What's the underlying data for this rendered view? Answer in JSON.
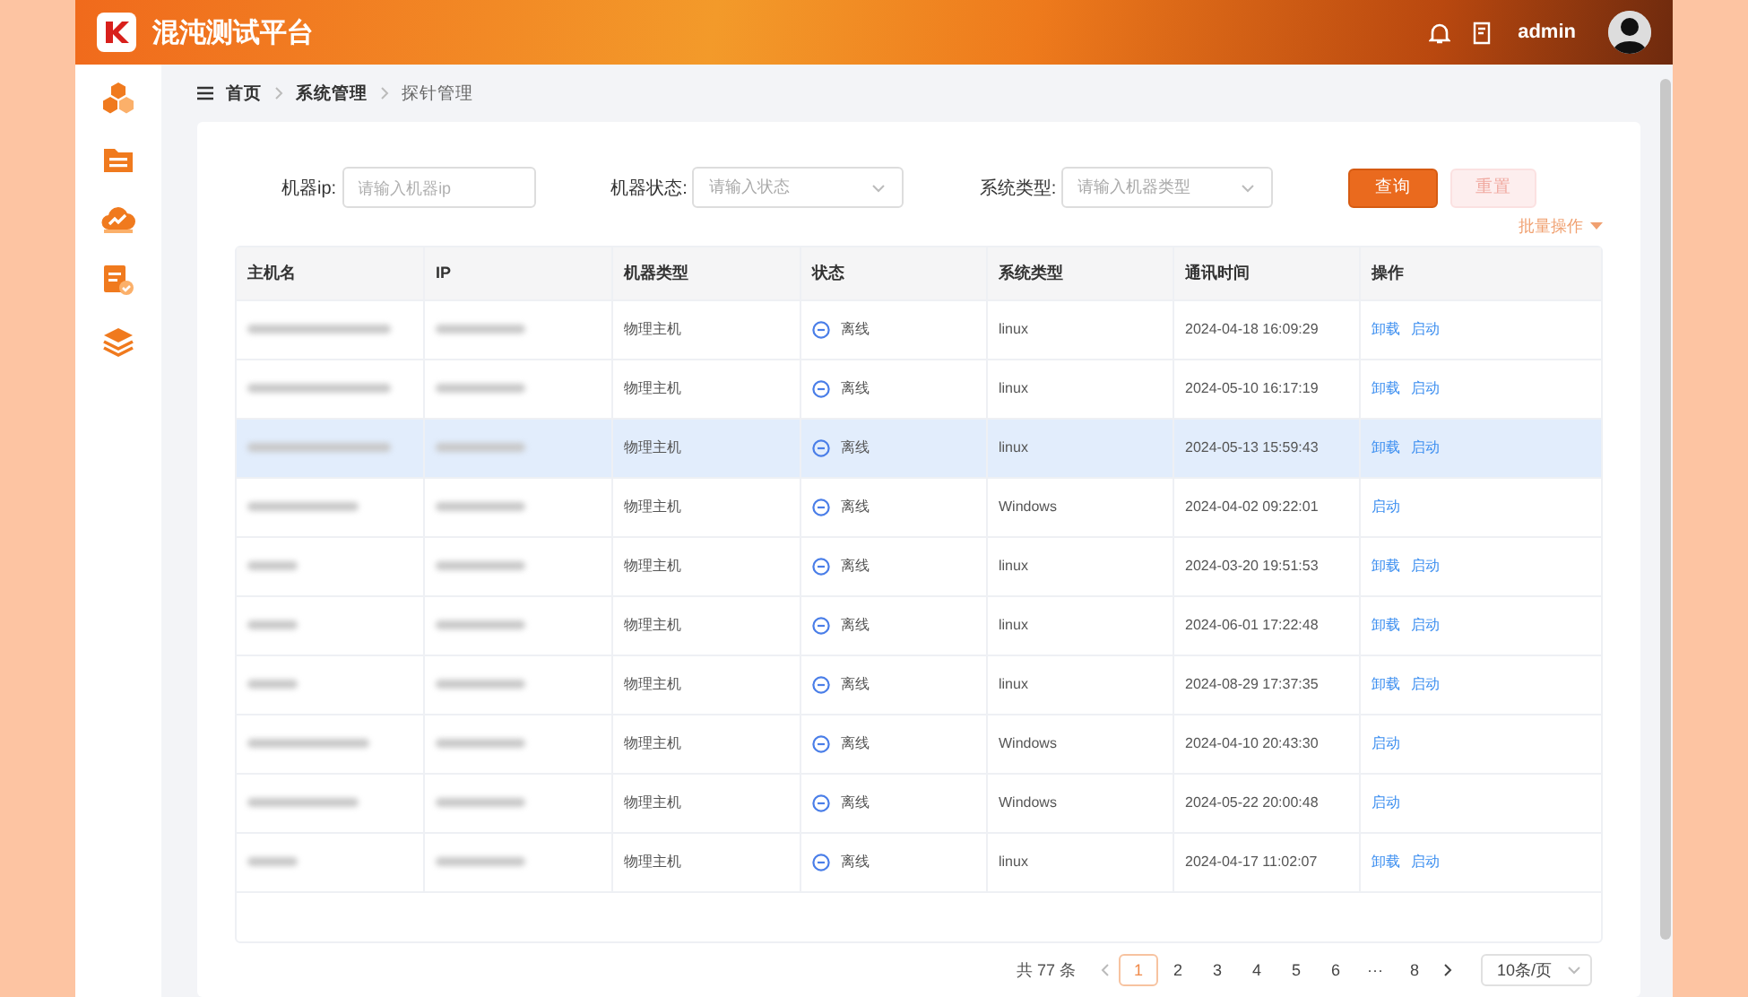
{
  "header": {
    "title": "混沌测试平台",
    "user": "admin"
  },
  "sidebar": {
    "items": [
      {
        "kind": "cubes"
      },
      {
        "kind": "folder"
      },
      {
        "kind": "cloud"
      },
      {
        "kind": "document"
      },
      {
        "kind": "layers"
      }
    ]
  },
  "breadcrumb": [
    "首页",
    "系统管理",
    "探针管理"
  ],
  "filters": [
    {
      "label": "机器ip:",
      "placeholder": "请输入机器ip",
      "kind": "input"
    },
    {
      "label": "机器状态:",
      "placeholder": "请输入状态",
      "kind": "select"
    },
    {
      "label": "系统类型:",
      "placeholder": "请输入机器类型",
      "kind": "select"
    }
  ],
  "buttons": {
    "query": "查询",
    "reset": "重置",
    "batch": "批量操作"
  },
  "table": {
    "columns": [
      "主机名",
      "IP",
      "机器类型",
      "状态",
      "系统类型",
      "通讯时间",
      "操作"
    ],
    "rows": [
      {
        "selected": false,
        "type": "物理主机",
        "status": "离线",
        "os": "linux",
        "time": "2024-04-18 16:09:29",
        "actions": [
          "卸载",
          "启动"
        ]
      },
      {
        "selected": false,
        "type": "物理主机",
        "status": "离线",
        "os": "linux",
        "time": "2024-05-10 16:17:19",
        "actions": [
          "卸载",
          "启动"
        ]
      },
      {
        "selected": true,
        "type": "物理主机",
        "status": "离线",
        "os": "linux",
        "time": "2024-05-13 15:59:43",
        "actions": [
          "卸载",
          "启动"
        ]
      },
      {
        "selected": false,
        "type": "物理主机",
        "status": "离线",
        "os": "Windows",
        "time": "2024-04-02 09:22:01",
        "actions": [
          "启动"
        ]
      },
      {
        "selected": false,
        "type": "物理主机",
        "status": "离线",
        "os": "linux",
        "time": "2024-03-20 19:51:53",
        "actions": [
          "卸载",
          "启动"
        ]
      },
      {
        "selected": false,
        "type": "物理主机",
        "status": "离线",
        "os": "linux",
        "time": "2024-06-01 17:22:48",
        "actions": [
          "卸载",
          "启动"
        ]
      },
      {
        "selected": false,
        "type": "物理主机",
        "status": "离线",
        "os": "linux",
        "time": "2024-08-29 17:37:35",
        "actions": [
          "卸载",
          "启动"
        ]
      },
      {
        "selected": false,
        "type": "物理主机",
        "status": "离线",
        "os": "Windows",
        "time": "2024-04-10 20:43:30",
        "actions": [
          "启动"
        ]
      },
      {
        "selected": false,
        "type": "物理主机",
        "status": "离线",
        "os": "Windows",
        "time": "2024-05-22 20:00:48",
        "actions": [
          "启动"
        ]
      },
      {
        "selected": false,
        "type": "物理主机",
        "status": "离线",
        "os": "linux",
        "time": "2024-04-17 11:02:07",
        "actions": [
          "卸载",
          "启动"
        ]
      }
    ]
  },
  "pagination": {
    "total": "共 77 条",
    "pages": [
      {
        "label": "1",
        "selected": true
      },
      {
        "label": "2",
        "selected": false
      },
      {
        "label": "3",
        "selected": false
      },
      {
        "label": "4",
        "selected": false
      },
      {
        "label": "5",
        "selected": false
      },
      {
        "label": "6",
        "selected": false
      },
      {
        "label": "···",
        "selected": false
      },
      {
        "label": "8",
        "selected": false
      }
    ],
    "page_size": "10条/页"
  }
}
